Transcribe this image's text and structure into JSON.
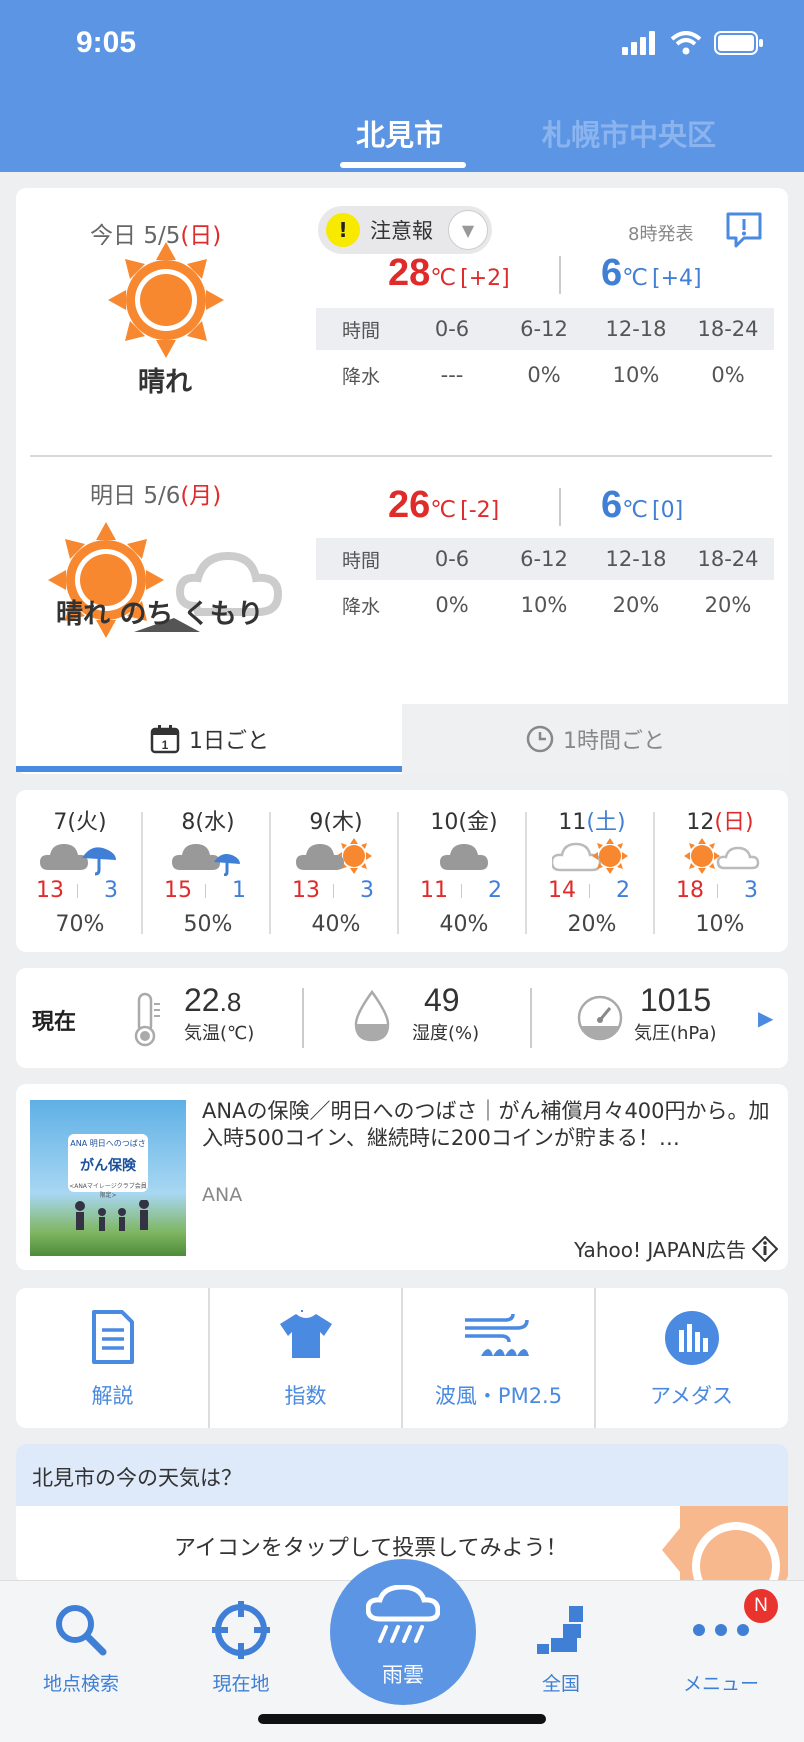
{
  "status_bar": {
    "time": "9:05"
  },
  "location_tabs": [
    "北見市",
    "札幌市中央区"
  ],
  "today": {
    "label": "今日",
    "date": "5/5",
    "dow": "(日)",
    "weather": "晴れ",
    "alert": "注意報",
    "issued": "8時発表",
    "high": "28",
    "high_diff": "[+2]",
    "low": "6",
    "low_diff": "[+4]",
    "unit": "℃",
    "precip_header": [
      "時間",
      "0-6",
      "6-12",
      "12-18",
      "18-24"
    ],
    "precip_row": [
      "降水",
      "---",
      "0%",
      "10%",
      "0%"
    ]
  },
  "tomorrow": {
    "label": "明日",
    "date": "5/6",
    "dow": "(月)",
    "weather": "晴れ のち くもり",
    "high": "26",
    "high_diff": "[-2]",
    "low": "6",
    "low_diff": "[0]",
    "unit": "℃",
    "precip_header": [
      "時間",
      "0-6",
      "6-12",
      "12-18",
      "18-24"
    ],
    "precip_row": [
      "降水",
      "0%",
      "10%",
      "20%",
      "20%"
    ]
  },
  "mode_tabs": [
    "1日ごと",
    "1時間ごと"
  ],
  "weekly": [
    {
      "day": "7",
      "dow": "(火)",
      "hi": "13",
      "lo": "3",
      "prob": "70%",
      "icon": "cloud-umbrella-icon"
    },
    {
      "day": "8",
      "dow": "(水)",
      "hi": "15",
      "lo": "1",
      "prob": "50%",
      "icon": "cloud-umbrella-icon"
    },
    {
      "day": "9",
      "dow": "(木)",
      "hi": "13",
      "lo": "3",
      "prob": "40%",
      "icon": "cloud-sun-icon"
    },
    {
      "day": "10",
      "dow": "(金)",
      "hi": "11",
      "lo": "2",
      "prob": "40%",
      "icon": "cloud-icon"
    },
    {
      "day": "11",
      "dow": "(土)",
      "hi": "14",
      "lo": "2",
      "prob": "20%",
      "icon": "cloud-sun-icon"
    },
    {
      "day": "12",
      "dow": "(日)",
      "hi": "18",
      "lo": "3",
      "prob": "10%",
      "icon": "sun-cloud-icon"
    }
  ],
  "current": {
    "label": "現在",
    "temp_int": "22",
    "temp_dec": ".8",
    "temp_caption": "気温(℃)",
    "humidity": "49",
    "humidity_caption": "湿度(%)",
    "pressure": "1015",
    "pressure_caption": "気圧(hPa)"
  },
  "ad": {
    "title": "ANAの保険／明日へのつばさ｜がん補償月々400円から。加入時500コイン、継続時に200コインが貯まる！…",
    "sponsor": "ANA",
    "label": "Yahoo! JAPAN広告",
    "badge_top": "ANA 明日へのつばさ",
    "badge_main": "がん保険",
    "badge_sub": "<ANAマイレージクラブ会員限定>"
  },
  "quick_menu": [
    "解説",
    "指数",
    "波風・PM2.5",
    "アメダス"
  ],
  "vote": {
    "title": "北見市の今の天気は？",
    "text": "アイコンをタップして投票してみよう！"
  },
  "bottom_nav": {
    "search": "地点検索",
    "current": "現在地",
    "rain": "雨雲",
    "national": "全国",
    "menu": "メニュー",
    "badge": "N"
  },
  "colors": {
    "header": "#5b95e4",
    "high": "#e02b2b",
    "low": "#3f7fd6",
    "sun": "#f7882f"
  }
}
